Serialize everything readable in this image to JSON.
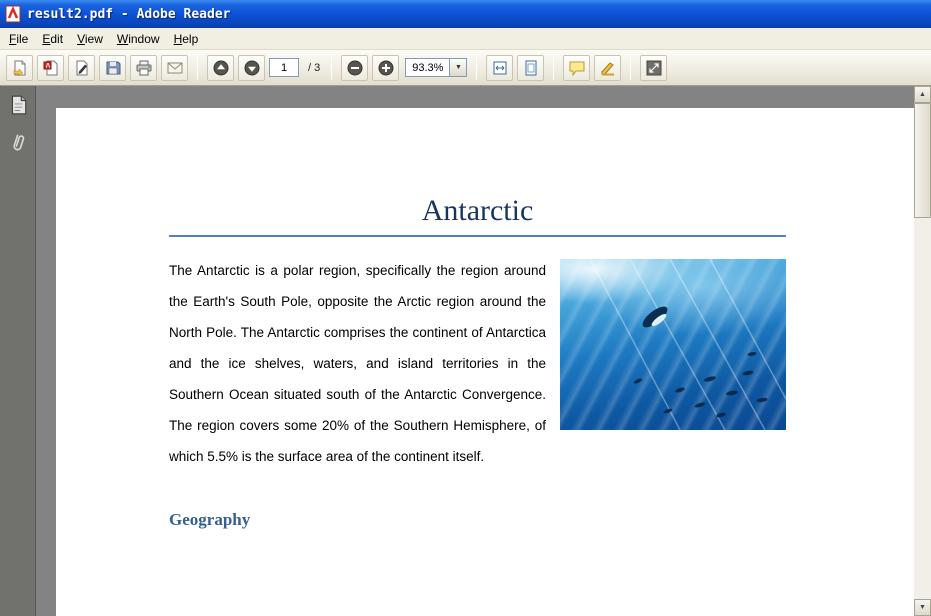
{
  "window": {
    "title": "result2.pdf - Adobe Reader"
  },
  "menu": {
    "items": [
      {
        "label": "File"
      },
      {
        "label": "Edit"
      },
      {
        "label": "View"
      },
      {
        "label": "Window"
      },
      {
        "label": "Help"
      }
    ]
  },
  "toolbar": {
    "page_current": "1",
    "page_total_label": "/ 3",
    "zoom_value": "93.3%",
    "dropdown_glyph": "▼",
    "icons": [
      "open-file",
      "create-pdf",
      "sign-document",
      "save",
      "print",
      "email",
      "previous-page",
      "next-page",
      "zoom-out",
      "zoom-in",
      "scroll-mode",
      "fit-page",
      "comment",
      "highlight",
      "fullscreen"
    ]
  },
  "sidebar": {
    "icons": [
      "page-thumbnails",
      "attachments"
    ]
  },
  "scrollbar": {
    "up_glyph": "▲",
    "down_glyph": "▼"
  },
  "document": {
    "title": "Antarctic",
    "body": "The Antarctic is a polar region, specifically the region around the Earth's South Pole, opposite the Arctic region around the North Pole. The Antarctic comprises the continent of Antarctica and the ice shelves, waters, and island territories in the Southern Ocean situated south of the Antarctic Convergence. The region covers some 20% of the Southern Hemisphere, of which 5.5% is the surface area of the continent itself.",
    "heading": "Geography"
  },
  "colors": {
    "title_text": "#17365d",
    "rule_blue": "#4f81bd",
    "heading_blue": "#365f91",
    "titlebar_blue": "#0c50d4"
  }
}
